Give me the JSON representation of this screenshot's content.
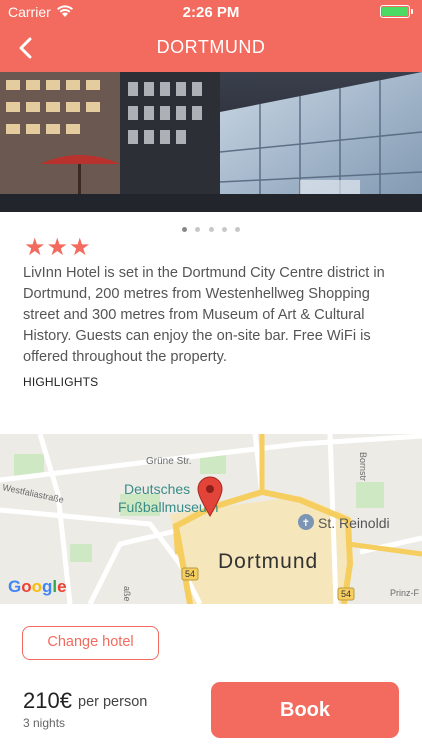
{
  "status_bar": {
    "carrier": "Carrier",
    "time": "2:26 PM",
    "battery_color": "#4cd964"
  },
  "nav": {
    "title": "DORTMUND",
    "back_icon": "chevron-left-icon",
    "color": "#f26b5e"
  },
  "gallery": {
    "image": "hotel-exterior-night",
    "page_count": 5,
    "current_page": 1
  },
  "hotel": {
    "stars": "★★★",
    "star_rating": 3,
    "description": "LivInn Hotel is set in the Dortmund City Centre district in Dortmund, 200 metres from Westenhellweg Shopping street and 300 metres from Museum of Art & Cultural History. Guests can enjoy the on-site bar. Free WiFi is offered throughout the property.",
    "highlights_label": "HIGHLIGHTS"
  },
  "map": {
    "city_label": "Dortmund",
    "poi_label_line1": "Deutsches",
    "poi_label_line2": "Fußballmuseum",
    "church_label": "St. Reinoldi",
    "street_1": "Grüne Str.",
    "street_2": "Westfaliastraße",
    "street_3": "Bornstr",
    "street_4": "Prinz-F",
    "street_5": "aße",
    "road_badge_1": "54",
    "road_badge_2": "54",
    "provider": "Google"
  },
  "booking": {
    "change_hotel_label": "Change hotel",
    "price": "210€",
    "price_suffix": "per person",
    "nights": "3 nights",
    "book_label": "Book"
  }
}
